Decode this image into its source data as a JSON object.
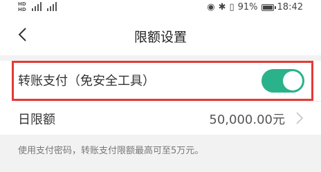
{
  "status_bar": {
    "left_label_1": "HD",
    "left_label_2": "HD",
    "signal_1": "4G",
    "signal_2": "4G",
    "battery_percent": "91%",
    "battery_level": 0.91,
    "time": "18:42",
    "icons": [
      "eye-icon",
      "bluetooth-icon",
      "vibrate-icon",
      "battery-icon"
    ]
  },
  "nav": {
    "title": "限额设置",
    "back_icon": "chevron-left-icon"
  },
  "transfer_payment": {
    "label": "转账支付（免安全工具）",
    "enabled": true,
    "toggle_color": "#2ab28a",
    "highlight_color": "#e53935"
  },
  "daily_limit": {
    "label": "日限额",
    "value": "50,000.00元",
    "chevron_icon": "chevron-right-icon"
  },
  "notice": {
    "text": "使用支付密码，转账支付限额最高可至5万元。"
  }
}
